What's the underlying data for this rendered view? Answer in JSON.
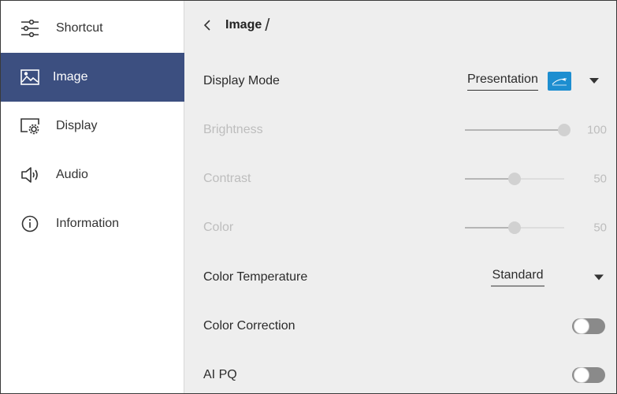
{
  "sidebar": {
    "items": [
      {
        "label": "Shortcut",
        "icon": "sliders-icon",
        "active": false
      },
      {
        "label": "Image",
        "icon": "image-icon",
        "active": true
      },
      {
        "label": "Display",
        "icon": "display-settings-icon",
        "active": false
      },
      {
        "label": "Audio",
        "icon": "speaker-icon",
        "active": false
      },
      {
        "label": "Information",
        "icon": "info-icon",
        "active": false
      }
    ],
    "active_color": "#3c4f80"
  },
  "header": {
    "title": "Image",
    "separator": "/"
  },
  "settings": {
    "display_mode": {
      "label": "Display Mode",
      "value": "Presentation",
      "badge": "energy star"
    },
    "brightness": {
      "label": "Brightness",
      "value": "100",
      "level": 100,
      "enabled": false
    },
    "contrast": {
      "label": "Contrast",
      "value": "50",
      "level": 50,
      "enabled": false
    },
    "color": {
      "label": "Color",
      "value": "50",
      "level": 50,
      "enabled": false
    },
    "color_temperature": {
      "label": "Color Temperature",
      "value": "Standard"
    },
    "color_correction": {
      "label": "Color Correction",
      "on": false
    },
    "ai_pq": {
      "label": "AI PQ",
      "on": false
    }
  }
}
